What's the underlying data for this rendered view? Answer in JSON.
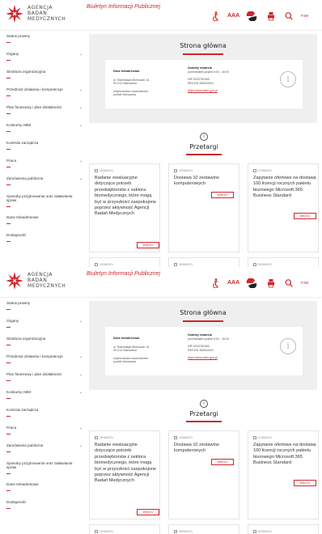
{
  "brand": {
    "line1": "AGENCJA",
    "line2": "BADAŃ",
    "line3": "MEDYCZNYCH"
  },
  "header": {
    "bip_title": "Biuletyn Informacji Publicznej",
    "icons": [
      "accessibility-icon",
      "text-size-icon",
      "contrast-icon",
      "print-icon",
      "search-icon",
      "sign-language-icon"
    ],
    "text_size_label": "AAA",
    "sign_label": "PJM"
  },
  "sidebar": {
    "items": [
      {
        "label": "Status prawny",
        "chevron": false
      },
      {
        "label": "Organy",
        "chevron": true
      },
      {
        "label": "Struktura organizacyjna",
        "chevron": false
      },
      {
        "label": "Przedmiot działania i kompetencje",
        "chevron": true
      },
      {
        "label": "Plan finansowy i plan działalności",
        "chevron": true
      },
      {
        "label": "Konkursy ABM",
        "chevron": true
      },
      {
        "label": "Kontrola zarządcza",
        "chevron": false
      },
      {
        "label": "Praca",
        "chevron": true
      },
      {
        "label": "Zamówienia publiczne",
        "chevron": true
      },
      {
        "label": "Sposoby przyjmowania oraz załatwiania spraw",
        "chevron": false
      },
      {
        "label": "Dane teleadresowe",
        "chevron": false
      },
      {
        "label": "Dostępność",
        "chevron": false
      }
    ]
  },
  "home": {
    "title": "Strona główna",
    "contact": {
      "heading": "Dane teleadresowe",
      "address1": "ul. Stanisława Moniuszki 1A",
      "address2": "00-014 Warszawa",
      "region1": "województwo mazowieckie",
      "region2": "powiat Warszawa"
    },
    "hours": {
      "heading": "Godziny otwarcia",
      "hours": "poniedziałek-piątek 8:00 - 16:00",
      "nip": "NIP 5252781960",
      "regon": "REGON 383632641",
      "link": "https://www.abm.gov.pl"
    }
  },
  "tenders": {
    "title": "Przetargi",
    "items": [
      {
        "date": "25/06/2021",
        "title": "Badanie ewaluacyjne dotyczące potrzeb przedsiębiorstw z sektora biomedycznego, które mogą być w przyszłości zaspokojone poprzez aktywność Agencji Badań Medycznych",
        "button": "WIĘCEJ"
      },
      {
        "date": "24/06/2021",
        "title": "Dostawa 10 zestawów komputerowych",
        "button": "WIĘCEJ"
      },
      {
        "date": "17/06/2021",
        "title": "Zapytanie ofertowe na dostawę 100 licencji rocznych pakietu biurowego Microsoft 365 Business Standard",
        "button": "WIĘCEJ"
      }
    ],
    "next_dates": [
      "10/06/2021",
      "08/06/2021",
      "02/06/2021"
    ]
  },
  "colors": {
    "accent": "#d0262d",
    "panel": "#efefef"
  }
}
